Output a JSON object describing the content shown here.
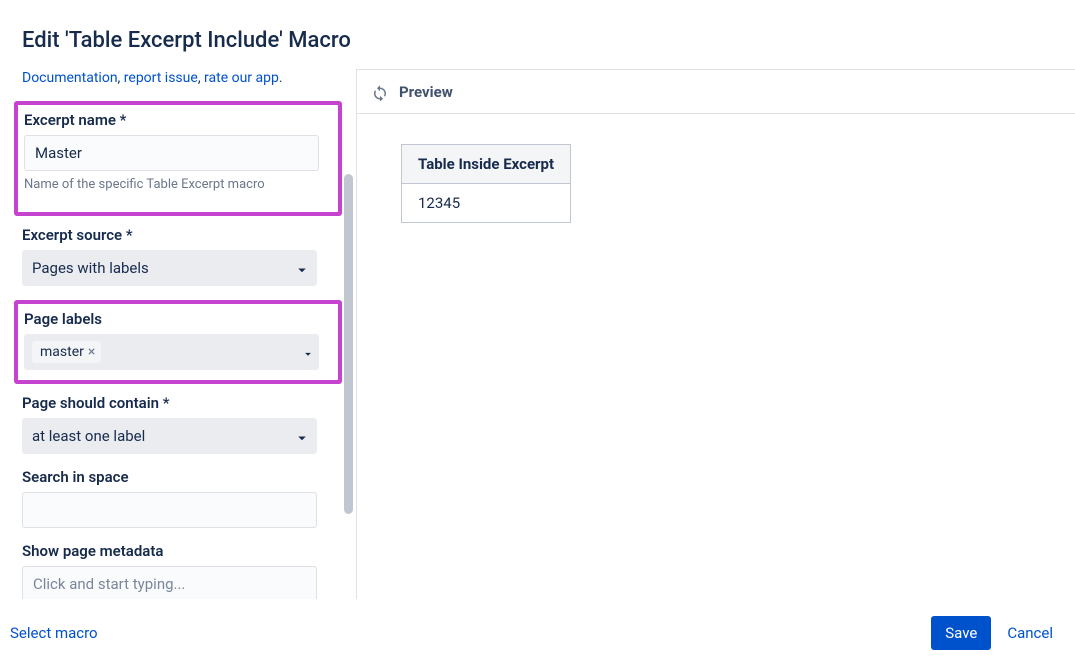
{
  "dialog": {
    "title": "Edit 'Table Excerpt Include' Macro"
  },
  "doc_links": {
    "documentation": "Documentation",
    "separator1": ", ",
    "report_issue": "report issue",
    "separator2": ", ",
    "rate_app": "rate our app",
    "period": "."
  },
  "form": {
    "excerpt_name": {
      "label": "Excerpt name *",
      "value": "Master",
      "help": "Name of the specific Table Excerpt macro"
    },
    "excerpt_source": {
      "label": "Excerpt source *",
      "value": "Pages with labels"
    },
    "page_labels": {
      "label": "Page labels",
      "chip": "master"
    },
    "page_should_contain": {
      "label": "Page should contain *",
      "value": "at least one label"
    },
    "search_in_space": {
      "label": "Search in space",
      "value": ""
    },
    "show_page_metadata": {
      "label": "Show page metadata",
      "placeholder": "Click and start typing..."
    }
  },
  "preview": {
    "header_label": "Preview",
    "table": {
      "header": "Table Inside Excerpt",
      "cell": "12345"
    }
  },
  "footer": {
    "select_macro": "Select macro",
    "save": "Save",
    "cancel": "Cancel"
  }
}
